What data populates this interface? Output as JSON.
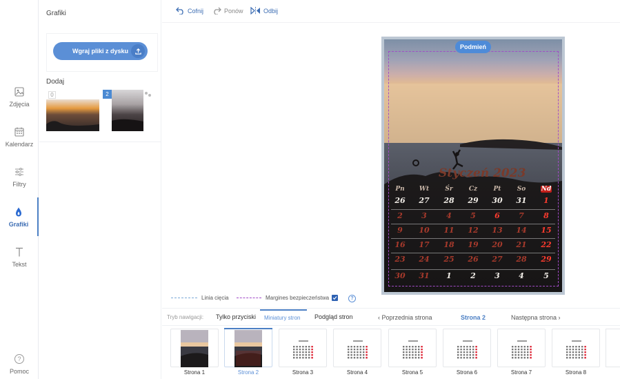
{
  "sidebar": {
    "items": [
      {
        "label": "Zdjęcia",
        "icon": "image-icon"
      },
      {
        "label": "Kalendarz",
        "icon": "calendar-icon"
      },
      {
        "label": "Filtry",
        "icon": "sliders-icon"
      },
      {
        "label": "Grafiki",
        "icon": "drop-icon"
      },
      {
        "label": "Tekst",
        "icon": "text-icon"
      }
    ],
    "help_label": "Pomoc",
    "accent": "#4b7fc4"
  },
  "panel": {
    "title": "Grafiki",
    "upload_label": "Wgraj pliki z dysku",
    "add_label": "Dodaj",
    "thumbs": [
      {
        "badge": "0"
      },
      {
        "badge": "2"
      }
    ]
  },
  "toolbar": {
    "undo_label": "Cofnij",
    "redo_label": "Ponów",
    "flip_label": "Odbij"
  },
  "editor": {
    "swap_label": "Podmień",
    "calendar": {
      "title": "Styczeń 2023",
      "weekdays": [
        "Pn",
        "Wt",
        "Śr",
        "Cz",
        "Pt",
        "So",
        "Nd"
      ],
      "weeks": [
        [
          "26",
          "27",
          "28",
          "29",
          "30",
          "31",
          "1"
        ],
        [
          "2",
          "3",
          "4",
          "5",
          "6",
          "7",
          "8"
        ],
        [
          "9",
          "10",
          "11",
          "12",
          "13",
          "14",
          "15"
        ],
        [
          "16",
          "17",
          "18",
          "19",
          "20",
          "21",
          "22"
        ],
        [
          "23",
          "24",
          "25",
          "26",
          "27",
          "28",
          "29"
        ],
        [
          "30",
          "31",
          "1",
          "2",
          "3",
          "4",
          "5"
        ]
      ]
    }
  },
  "legend": {
    "cut_line": "Linia cięcia",
    "safe_margin": "Margines bezpieczeństwa"
  },
  "nav": {
    "mode_label": "Tryb nawigacji:",
    "tabs": [
      "Tylko przyciski",
      "Miniatury stron",
      "Podgląd stron"
    ],
    "prev": "‹ Poprzednia strona",
    "current": "Strona 2",
    "next": "Następna strona ›"
  },
  "pages": [
    "Strona 1",
    "Strona 2",
    "Strona 3",
    "Strona 4",
    "Strona 5",
    "Strona 6",
    "Strona 7",
    "Strona 8"
  ]
}
